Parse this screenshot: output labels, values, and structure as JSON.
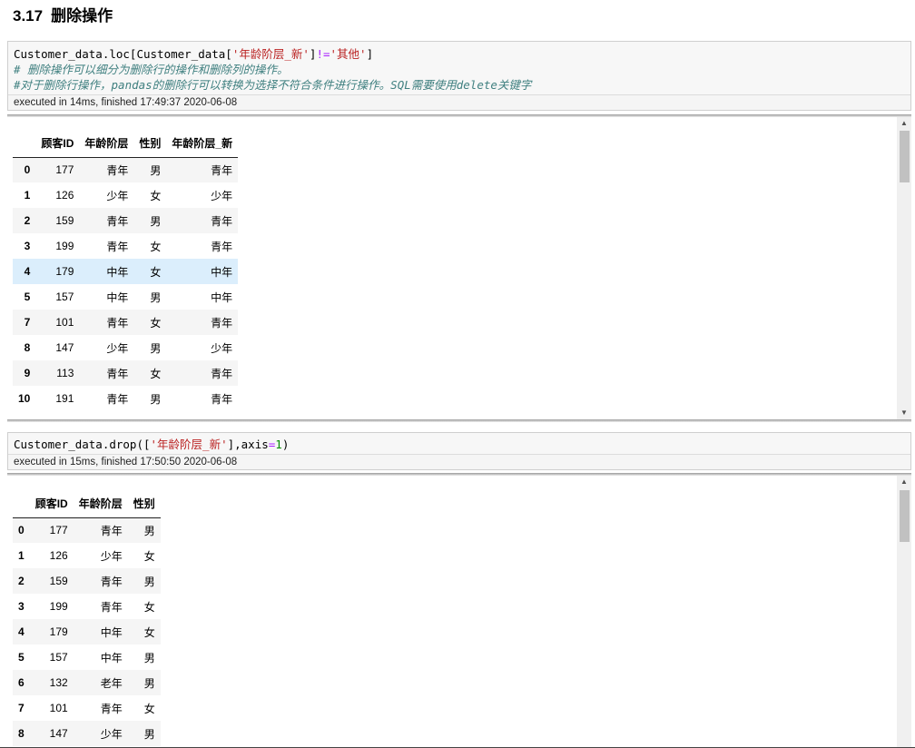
{
  "section": {
    "number": "3.17",
    "title": "删除操作"
  },
  "cell1": {
    "code": {
      "line1_a": "Customer_data.loc[Customer_data[",
      "line1_b": "'年龄阶层_新'",
      "line1_c": "]",
      "line1_d": "!=",
      "line1_e": "'其他'",
      "line1_f": "]",
      "comment1": "# 删除操作可以细分为删除行的操作和删除列的操作。",
      "comment2": "#对于删除行操作，pandas的删除行可以转换为选择不符合条件进行操作。SQL需要使用delete关键字"
    },
    "exec_info": "executed in 14ms, finished 17:49:37 2020-06-08",
    "columns": [
      "",
      "顾客ID",
      "年龄阶层",
      "性别",
      "年龄阶层_新"
    ],
    "rows": [
      {
        "idx": "0",
        "id": "177",
        "age": "青年",
        "sex": "男",
        "new": "青年"
      },
      {
        "idx": "1",
        "id": "126",
        "age": "少年",
        "sex": "女",
        "new": "少年"
      },
      {
        "idx": "2",
        "id": "159",
        "age": "青年",
        "sex": "男",
        "new": "青年"
      },
      {
        "idx": "3",
        "id": "199",
        "age": "青年",
        "sex": "女",
        "new": "青年"
      },
      {
        "idx": "4",
        "id": "179",
        "age": "中年",
        "sex": "女",
        "new": "中年"
      },
      {
        "idx": "5",
        "id": "157",
        "age": "中年",
        "sex": "男",
        "new": "中年"
      },
      {
        "idx": "7",
        "id": "101",
        "age": "青年",
        "sex": "女",
        "new": "青年"
      },
      {
        "idx": "8",
        "id": "147",
        "age": "少年",
        "sex": "男",
        "new": "少年"
      },
      {
        "idx": "9",
        "id": "113",
        "age": "青年",
        "sex": "女",
        "new": "青年"
      },
      {
        "idx": "10",
        "id": "191",
        "age": "青年",
        "sex": "男",
        "new": "青年"
      }
    ]
  },
  "cell2": {
    "code": {
      "a": "Customer_data.drop([",
      "b": "'年龄阶层_新'",
      "c": "],axis",
      "d": "=",
      "e": "1",
      "f": ")"
    },
    "exec_info": "executed in 15ms, finished 17:50:50 2020-06-08",
    "columns": [
      "",
      "顾客ID",
      "年龄阶层",
      "性别"
    ],
    "rows": [
      {
        "idx": "0",
        "id": "177",
        "age": "青年",
        "sex": "男"
      },
      {
        "idx": "1",
        "id": "126",
        "age": "少年",
        "sex": "女"
      },
      {
        "idx": "2",
        "id": "159",
        "age": "青年",
        "sex": "男"
      },
      {
        "idx": "3",
        "id": "199",
        "age": "青年",
        "sex": "女"
      },
      {
        "idx": "4",
        "id": "179",
        "age": "中年",
        "sex": "女"
      },
      {
        "idx": "5",
        "id": "157",
        "age": "中年",
        "sex": "男"
      },
      {
        "idx": "6",
        "id": "132",
        "age": "老年",
        "sex": "男"
      },
      {
        "idx": "7",
        "id": "101",
        "age": "青年",
        "sex": "女"
      },
      {
        "idx": "8",
        "id": "147",
        "age": "少年",
        "sex": "男"
      }
    ]
  },
  "icons": {
    "scroll_up": "scroll-up-arrow-icon",
    "scroll_down": "scroll-down-arrow-icon"
  },
  "colors": {
    "string": "#ba2121",
    "operator": "#aa22ff",
    "number": "#008800",
    "comment": "#408080",
    "row_highlight": "#dbeefc"
  }
}
